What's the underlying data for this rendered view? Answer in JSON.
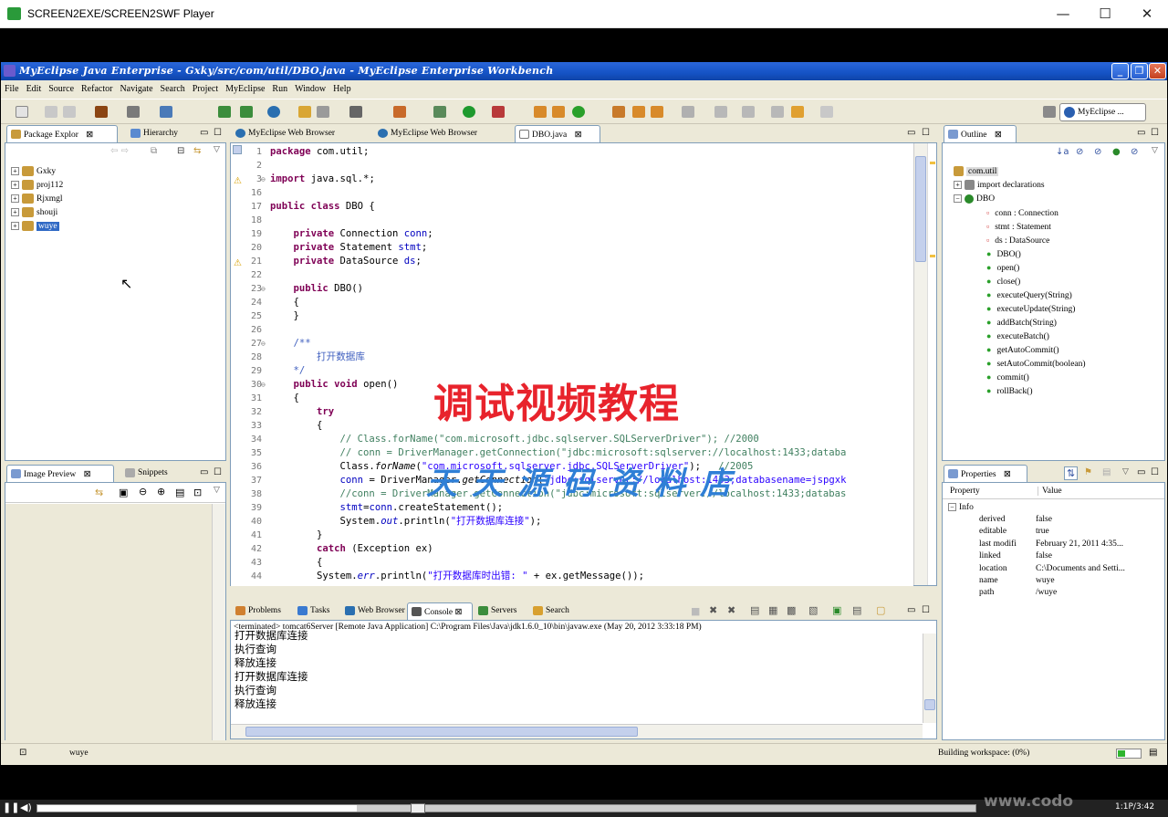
{
  "player": {
    "title": "SCREEN2EXE/SCREEN2SWF Player",
    "time": "1:1P/3:42",
    "progress": 0.34
  },
  "window": {
    "title": "MyEclipse Java Enterprise - Gxky/src/com/util/DBO.java - MyEclipse Enterprise Workbench"
  },
  "menu": [
    "File",
    "Edit",
    "Source",
    "Refactor",
    "Navigate",
    "Search",
    "Project",
    "MyEclipse",
    "Run",
    "Window",
    "Help"
  ],
  "perspective": "MyEclipse ...",
  "package_explorer": {
    "tabs": [
      "Package Explor",
      "Hierarchy"
    ],
    "projects": [
      "Gxky",
      "proj112",
      "Rjxmgl",
      "shouji",
      "wuye"
    ],
    "selected": "wuye"
  },
  "image_preview": {
    "tabs": [
      "Image Preview",
      "Snippets"
    ]
  },
  "editor": {
    "tabs": [
      "MyEclipse Web Browser",
      "MyEclipse Web Browser",
      "DBO.java"
    ],
    "lines": [
      {
        "n": "1",
        "html": "<span class='kw'>package</span> com.util;"
      },
      {
        "n": "2",
        "html": ""
      },
      {
        "n": "3",
        "html": "<span class='kw'>import</span> java.sql.*;"
      },
      {
        "n": "16",
        "html": ""
      },
      {
        "n": "17",
        "html": "<span class='kw'>public class</span> DBO {"
      },
      {
        "n": "18",
        "html": ""
      },
      {
        "n": "19",
        "html": "    <span class='kw'>private</span> Connection <span class='fd'>conn</span>;"
      },
      {
        "n": "20",
        "html": "    <span class='kw'>private</span> Statement <span class='fd'>stmt</span>;"
      },
      {
        "n": "21",
        "html": "    <span class='kw'>private</span> DataSource <span class='fd'>ds</span>;"
      },
      {
        "n": "22",
        "html": ""
      },
      {
        "n": "23",
        "html": "    <span class='kw'>public</span> DBO()"
      },
      {
        "n": "24",
        "html": "    {"
      },
      {
        "n": "25",
        "html": "    }"
      },
      {
        "n": "26",
        "html": ""
      },
      {
        "n": "27",
        "html": "    <span class='jd'>/**</span>"
      },
      {
        "n": "28",
        "html": "<span class='jd'>        打开数据库</span>"
      },
      {
        "n": "29",
        "html": "<span class='jd'>    */</span>"
      },
      {
        "n": "30",
        "html": "    <span class='kw'>public void</span> open()"
      },
      {
        "n": "31",
        "html": "    {"
      },
      {
        "n": "32",
        "html": "        <span class='kw'>try</span>"
      },
      {
        "n": "33",
        "html": "        {"
      },
      {
        "n": "34",
        "html": "<span class='cm'>            // Class.forName(\"com.microsoft.jdbc.sqlserver.SQLServerDriver\"); //2000</span>"
      },
      {
        "n": "35",
        "html": "<span class='cm'>            // conn = DriverManager.getConnection(\"jdbc:microsoft:sqlserver://localhost:1433;databa</span>"
      },
      {
        "n": "36",
        "html": "            Class.<span class='it'>forName</span>(<span class='st'>\"com.microsoft.sqlserver.jdbc.SQLServerDriver\"</span>);   <span class='cm'>//2005</span>"
      },
      {
        "n": "37",
        "html": "            <span class='fd'>conn</span> = DriverManager.<span class='it'>getConnection</span>(<span class='st'>\"jdbc:sqlserver://localhost:1433;databasename=jspgxk</span>"
      },
      {
        "n": "38",
        "html": "<span class='cm'>            //conn = DriverManager.getConnection(\"jdbc:microsoft:sqlserver://localhost:1433;databas</span>"
      },
      {
        "n": "39",
        "html": "            <span class='fd'>stmt</span>=<span class='fd'>conn</span>.createStatement();"
      },
      {
        "n": "40",
        "html": "            System.<span class='fd it'>out</span>.println(<span class='st'>\"打开数据库连接\"</span>);"
      },
      {
        "n": "41",
        "html": "        }"
      },
      {
        "n": "42",
        "html": "        <span class='kw'>catch</span> (Exception ex)"
      },
      {
        "n": "43",
        "html": "        {"
      },
      {
        "n": "44",
        "html": "        System.<span class='fd it'>err</span>.println(<span class='st'>\"打开数据库时出错: \"</span> + ex.getMessage());"
      }
    ],
    "watermark_title": "调试视频教程",
    "watermark_shop": "天天源码资料店"
  },
  "console": {
    "tabs": [
      "Problems",
      "Tasks",
      "Web Browser",
      "Console",
      "Servers",
      "Search"
    ],
    "header": "<terminated> tomcat6Server [Remote Java Application] C:\\Program Files\\Java\\jdk1.6.0_10\\bin\\javaw.exe (May 20, 2012 3:33:18 PM)",
    "lines": [
      "打开数据库连接",
      "执行查询",
      "释放连接",
      "打开数据库连接",
      "执行查询",
      "释放连接"
    ]
  },
  "outline": {
    "tab": "Outline",
    "items": [
      {
        "label": "com.util",
        "indent": 0
      },
      {
        "label": "import declarations",
        "indent": 0
      },
      {
        "label": "DBO",
        "indent": 0
      },
      {
        "label": "conn : Connection",
        "indent": 1
      },
      {
        "label": "stmt : Statement",
        "indent": 1
      },
      {
        "label": "ds : DataSource",
        "indent": 1
      },
      {
        "label": "DBO()",
        "indent": 1
      },
      {
        "label": "open()",
        "indent": 1
      },
      {
        "label": "close()",
        "indent": 1
      },
      {
        "label": "executeQuery(String)",
        "indent": 1
      },
      {
        "label": "executeUpdate(String)",
        "indent": 1
      },
      {
        "label": "addBatch(String)",
        "indent": 1
      },
      {
        "label": "executeBatch()",
        "indent": 1
      },
      {
        "label": "getAutoCommit()",
        "indent": 1
      },
      {
        "label": "setAutoCommit(boolean)",
        "indent": 1
      },
      {
        "label": "commit()",
        "indent": 1
      },
      {
        "label": "rollBack()",
        "indent": 1
      }
    ]
  },
  "properties": {
    "tab": "Properties",
    "col_property": "Property",
    "col_value": "Value",
    "group": "Info",
    "rows": [
      {
        "k": "derived",
        "v": "false"
      },
      {
        "k": "editable",
        "v": "true"
      },
      {
        "k": "last modifi",
        "v": "February 21, 2011 4:35..."
      },
      {
        "k": "linked",
        "v": "false"
      },
      {
        "k": "location",
        "v": "C:\\Documents and Setti..."
      },
      {
        "k": "name",
        "v": "wuye"
      },
      {
        "k": "path",
        "v": "/wuye"
      }
    ]
  },
  "status": {
    "selection": "wuye",
    "task": "Building workspace: (0%)"
  },
  "colors": {
    "accent": "#316ac5",
    "watermark_red": "#e8232c",
    "watermark_blue": "#2f7fd6"
  }
}
